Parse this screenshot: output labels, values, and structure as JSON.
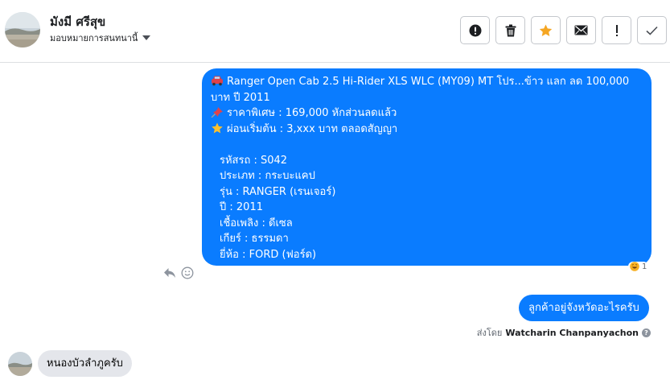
{
  "header": {
    "contact_name": "มังมี ศรีสุข",
    "assign_label": "มอบหมายการสนทนานี้",
    "action_icons": [
      "alert-circle-icon",
      "trash-icon",
      "star-icon",
      "envelope-icon",
      "exclamation-icon",
      "checkmark-icon"
    ]
  },
  "colors": {
    "bubble_out": "#0a7cff",
    "bubble_in": "#e4e6eb",
    "star_active": "#f5a623"
  },
  "messages": {
    "listing": {
      "title": "Ranger Open Cab 2.5 Hi-Rider XLS WLC (MY09) MT โปร...ข้าว แลก ลด 100,000",
      "title_cont": "บาท ปี 2011",
      "price": "ราคาพิเศษ : 169,000 หักส่วนลดแล้ว",
      "installment": "ผ่อนเริ่มต้น : 3,xxx บาท ตลอดสัญญา",
      "details": [
        "รหัสรถ : S042",
        "ประเภท : กระบะแคป",
        "รุ่น : RANGER (เรนเจอร์)",
        "ปี : 2011",
        "เชื้อเพลิง : ดีเซล",
        "เกียร์ : ธรรมดา",
        "ยี่ห้อ : FORD (ฟอร์ด)"
      ],
      "reaction_count": "1"
    },
    "outgoing_question": "ลูกค้าอยู่จังหวัดอะไรครับ",
    "sent_by_label": "ส่งโดย",
    "sent_by_name": "Watcharin Chanpanyachon",
    "incoming_reply": "หนองบัวลำภูครับ"
  }
}
